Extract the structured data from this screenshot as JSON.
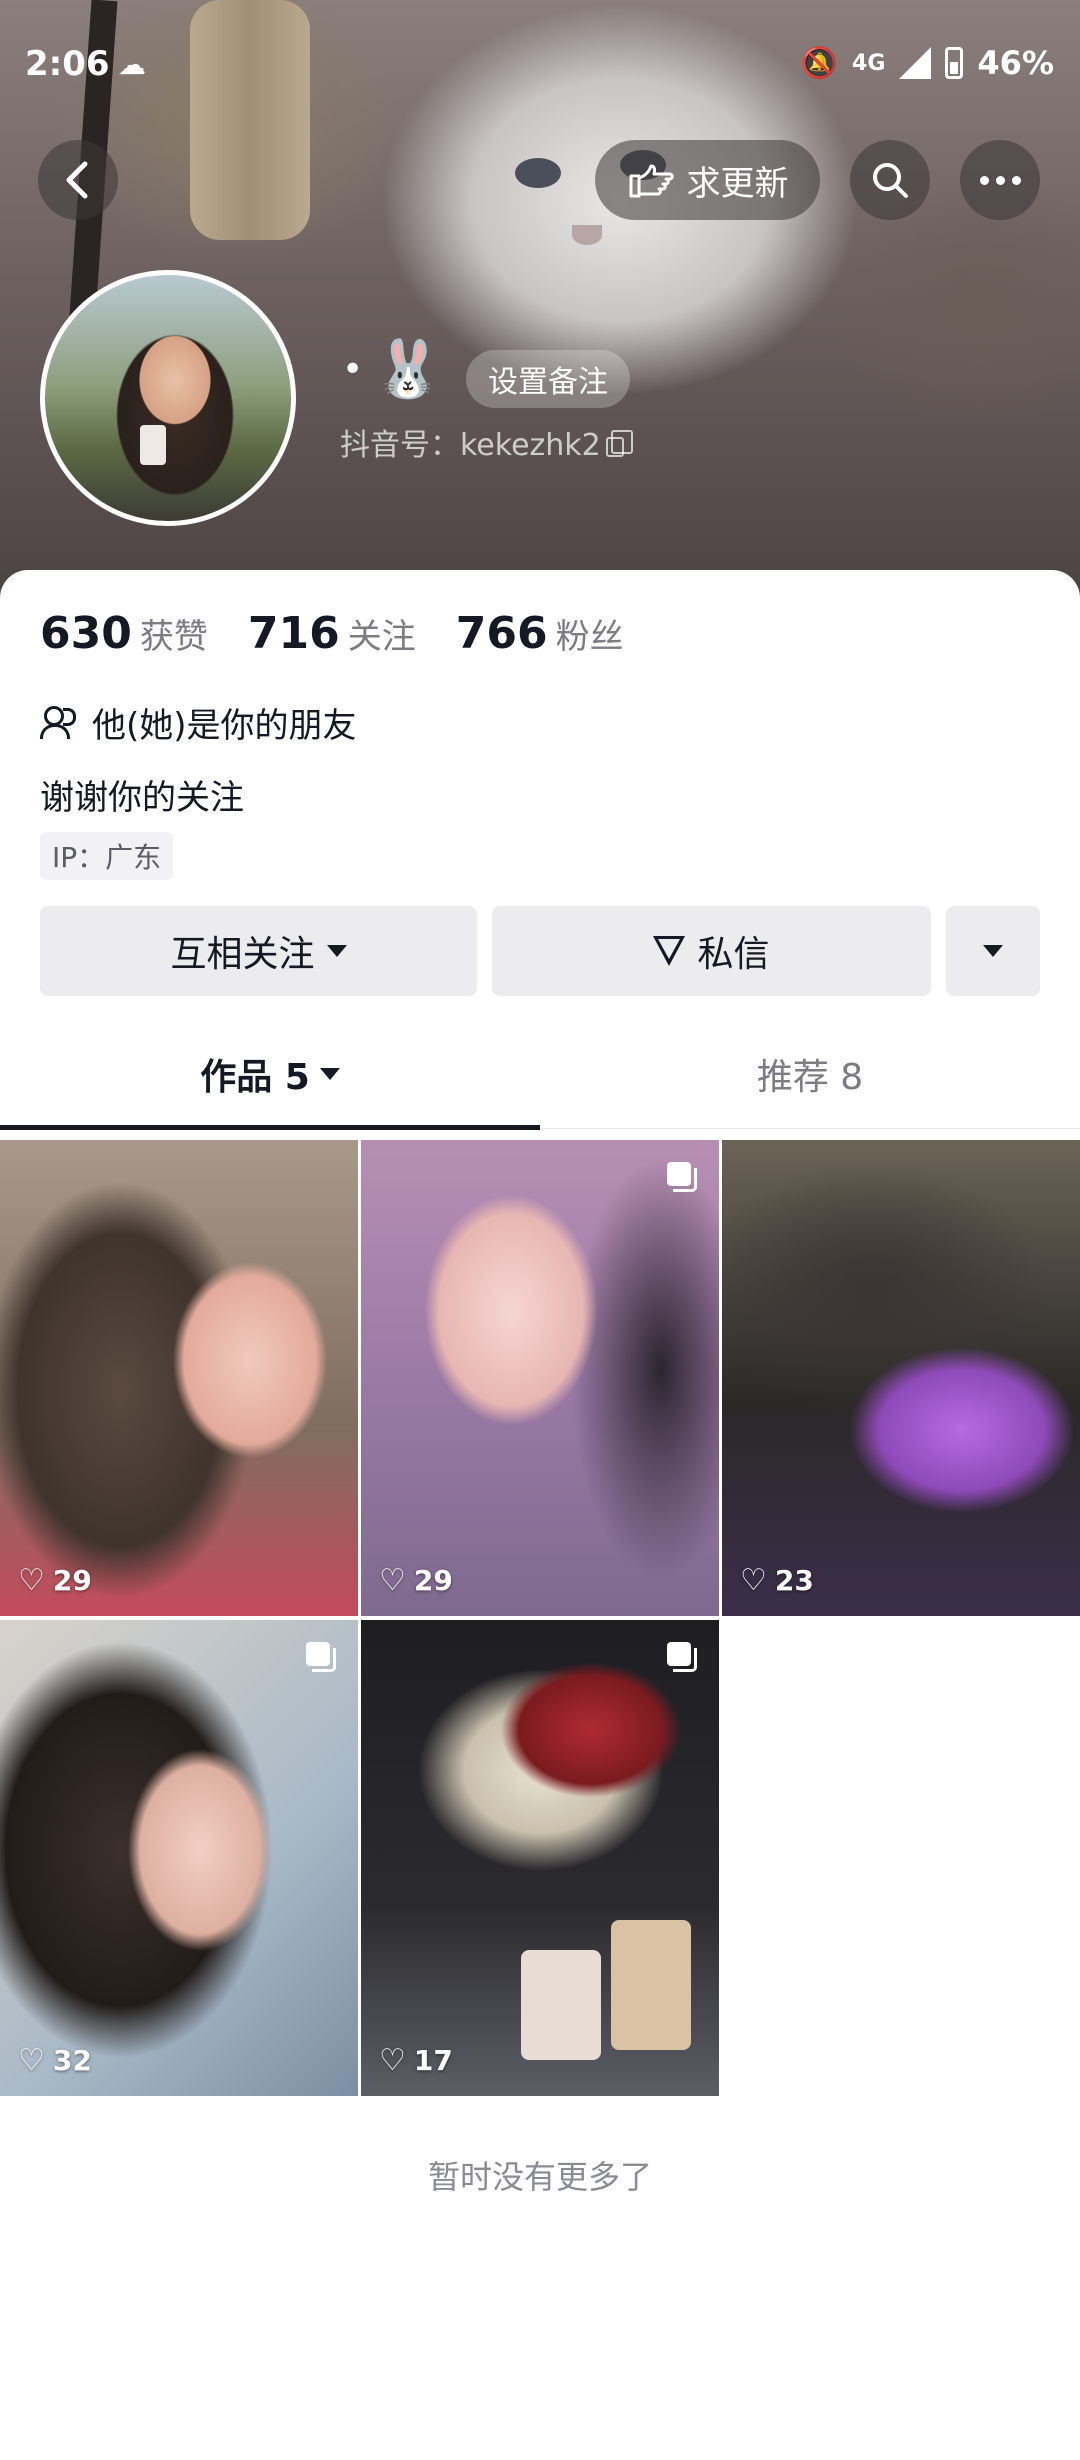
{
  "status_bar": {
    "time": "2:06",
    "network": "4G",
    "battery": "46%"
  },
  "top_nav": {
    "request_update_label": "求更新"
  },
  "profile": {
    "nickname_prefix": "•",
    "nickname_emoji": "🐰",
    "remark_button": "设置备注",
    "douyin_id": "抖音号：kekezhk2"
  },
  "stats": [
    {
      "num": "630",
      "label": "获赞"
    },
    {
      "num": "716",
      "label": "关注"
    },
    {
      "num": "766",
      "label": "粉丝"
    }
  ],
  "friend_text": "他(她)是你的朋友",
  "bio": "谢谢你的关注",
  "ip_location": "IP：广东",
  "actions": {
    "follow": "互相关注",
    "message": "私信"
  },
  "tabs": [
    {
      "label": "作品 5",
      "active": true
    },
    {
      "label": "推荐 8",
      "active": false
    }
  ],
  "videos": [
    {
      "likes": "29",
      "multi": false
    },
    {
      "likes": "29",
      "multi": true
    },
    {
      "likes": "23",
      "multi": false
    },
    {
      "likes": "32",
      "multi": true
    },
    {
      "likes": "17",
      "multi": true
    }
  ],
  "footer_text": "暂时没有更多了"
}
